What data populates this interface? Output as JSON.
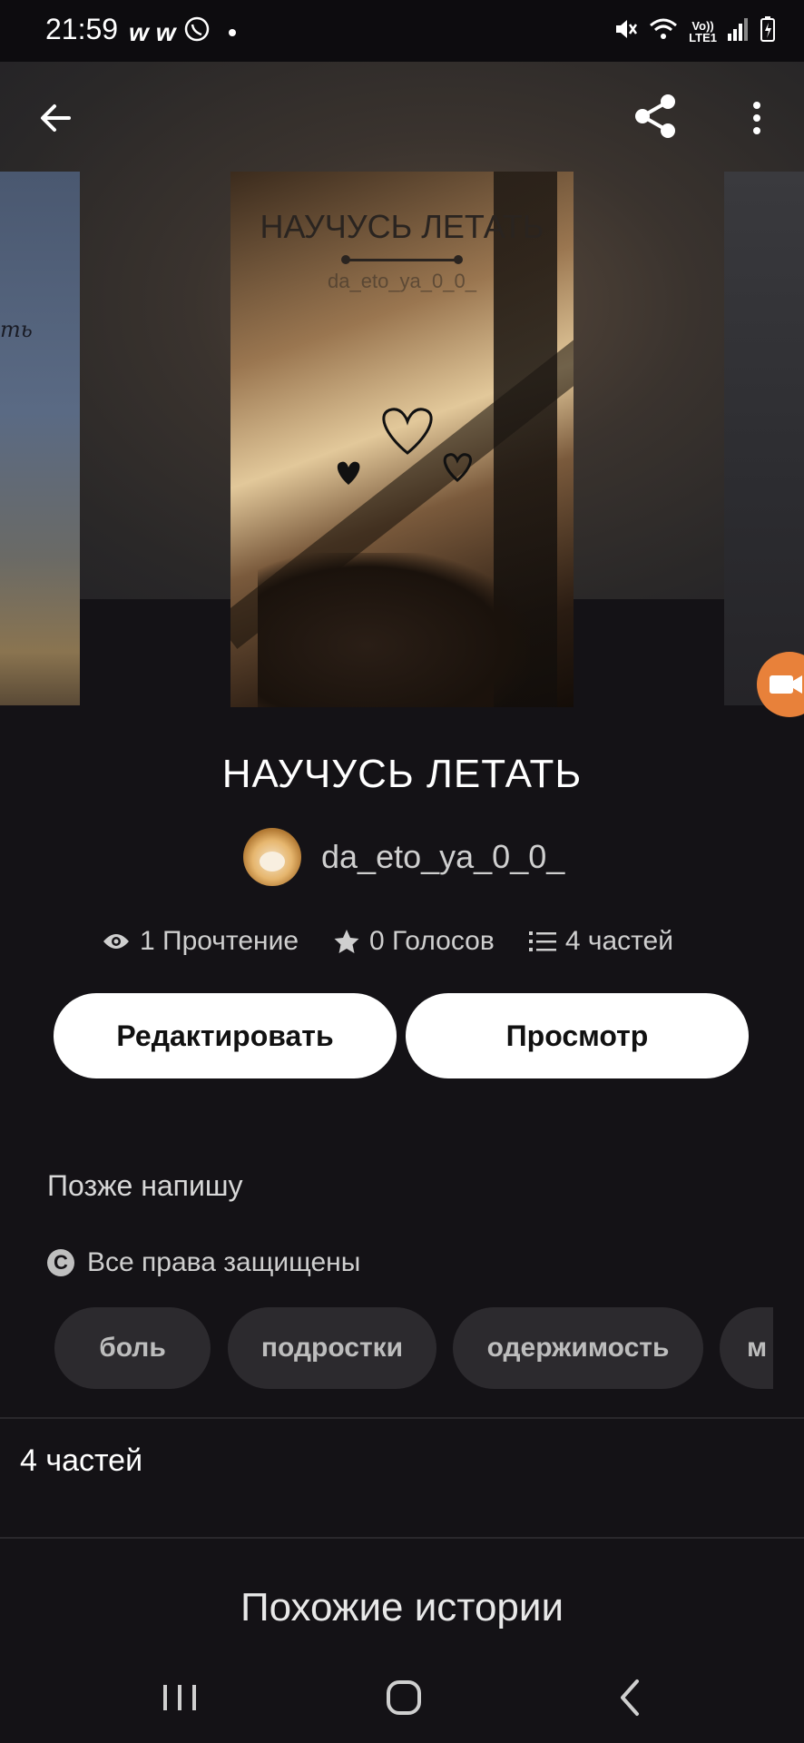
{
  "status_bar": {
    "time": "21:59",
    "left_icons": [
      "w-app-icon",
      "w-app-icon",
      "viber-icon",
      "dot"
    ],
    "network_label_1": "Vo))",
    "network_label_2": "LTE1"
  },
  "header": {
    "back_icon": "arrow-left-icon",
    "share_icon": "share-icon",
    "more_icon": "more-vertical-icon"
  },
  "cover": {
    "title": "НАУЧУСЬ ЛЕТАТЬ",
    "author": "da_eto_ya_0_0_",
    "left_cover_text": "ть"
  },
  "story": {
    "title": "НАУЧУСЬ ЛЕТАТЬ",
    "author": "da_eto_ya_0_0_",
    "stats": {
      "reads": "1 Прочтение",
      "votes": "0 Голосов",
      "parts": "4 частей"
    },
    "description": "Позже напишу",
    "rights": "Все права защищены",
    "tags": [
      "боль",
      "подростки",
      "одержимость",
      "м"
    ]
  },
  "buttons": {
    "edit": "Редактировать",
    "view": "Просмотр"
  },
  "parts_section": {
    "label": "4 частей"
  },
  "similar": {
    "heading": "Похожие истории"
  },
  "colors": {
    "background": "#141216",
    "button_bg": "#ffffff",
    "tag_bg": "#2c2a2e",
    "record_button": "#e8813a"
  }
}
